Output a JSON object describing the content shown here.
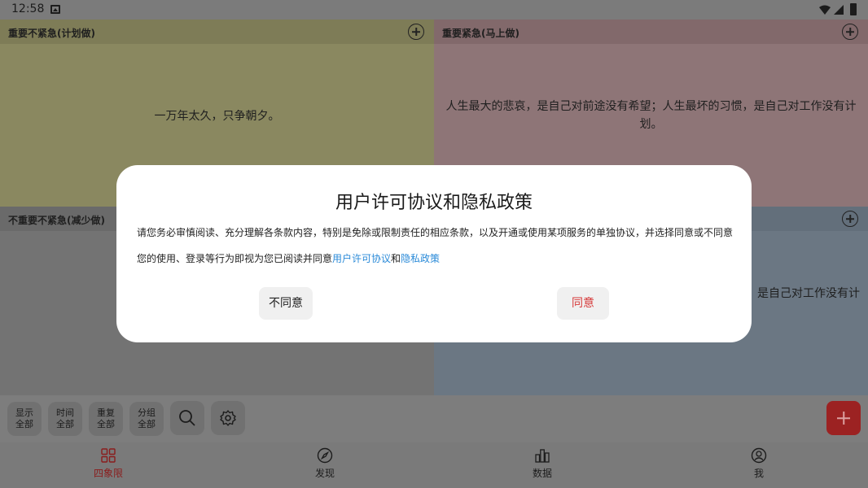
{
  "status_bar": {
    "time": "12:58"
  },
  "quadrants": [
    {
      "title": "重要不紧急(计划做)",
      "content": "一万年太久，只争朝夕。"
    },
    {
      "title": "重要紧急(马上做)",
      "content": "人生最大的悲哀，是自己对前途没有希望；人生最坏的习惯，是自己对工作没有计划。"
    },
    {
      "title": "不重要不紧急(减少做)",
      "content": ""
    },
    {
      "title": "",
      "content": "是自己对工作没有计"
    }
  ],
  "toolbar": {
    "filters": [
      {
        "line1": "显示",
        "line2": "全部"
      },
      {
        "line1": "时间",
        "line2": "全部"
      },
      {
        "line1": "重复",
        "line2": "全部"
      },
      {
        "line1": "分组",
        "line2": "全部"
      }
    ],
    "search_icon": "search-icon",
    "settings_icon": "gear-icon",
    "fab_icon": "plus-icon"
  },
  "bottom_nav": [
    {
      "label": "四象限",
      "icon": "grid-icon",
      "active": true
    },
    {
      "label": "发现",
      "icon": "compass-icon",
      "active": false
    },
    {
      "label": "数据",
      "icon": "bar-chart-icon",
      "active": false
    },
    {
      "label": "我",
      "icon": "user-icon",
      "active": false
    }
  ],
  "dialog": {
    "title": "用户许可协议和隐私政策",
    "line1": "请您务必审慎阅读、充分理解各条款内容，特别是免除或限制责任的相应条款，以及开通或使用某项服务的单独协议，并选择同意或不同意",
    "line2_prefix": "您的使用、登录等行为即视为您已阅读并同意",
    "link1": "用户许可协议",
    "line2_and": "和",
    "link2": "隐私政策",
    "disagree_label": "不同意",
    "agree_label": "同意"
  },
  "colors": {
    "accent": "#d63a3a",
    "link": "#2a8ad8"
  }
}
